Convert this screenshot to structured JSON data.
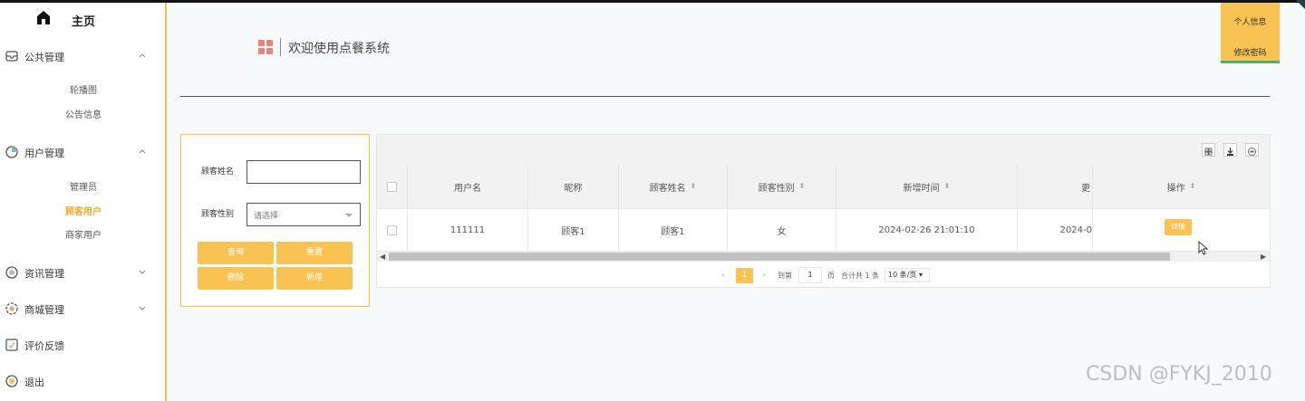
{
  "sidebar": {
    "home_label": "主页",
    "groups": [
      {
        "label": "公共管理",
        "items": [
          "轮播图",
          "公告信息"
        ]
      },
      {
        "label": "用户管理",
        "items": [
          "管理员",
          "顾客用户",
          "商家用户"
        ]
      },
      {
        "label": "资讯管理"
      },
      {
        "label": "商城管理"
      },
      {
        "label": "评价反馈"
      },
      {
        "label": "退出"
      }
    ],
    "active_item": "顾客用户"
  },
  "user_menu": {
    "profile": "个人信息",
    "change_password": "修改密码"
  },
  "page": {
    "title": "欢迎使用点餐系统"
  },
  "search": {
    "name_label": "顾客姓名",
    "name_value": "",
    "gender_label": "顾客性别",
    "gender_placeholder": "请选择",
    "buttons": {
      "query": "查询",
      "reset": "重置",
      "delete": "删除",
      "add": "新增"
    }
  },
  "table": {
    "columns": [
      "用户名",
      "昵称",
      "顾客姓名",
      "顾客性别",
      "新增时间",
      "更",
      "操作"
    ],
    "rows": [
      {
        "username": "111111",
        "nickname": "顾客1",
        "name": "顾客1",
        "gender": "女",
        "created": "2024-02-26 21:01:10",
        "updated": "2024-0",
        "action": "详情"
      }
    ]
  },
  "pagination": {
    "current": "1",
    "goto_label": "到第",
    "goto_value": "1",
    "page_unit": "页",
    "total": "合计共 1 条",
    "page_size": "10 条/页"
  },
  "watermark": "CSDN @FYKJ_2010",
  "colors": {
    "accent": "#f8c352",
    "sidebar_border": "#f5c04a",
    "active_text": "#f0a92a"
  }
}
